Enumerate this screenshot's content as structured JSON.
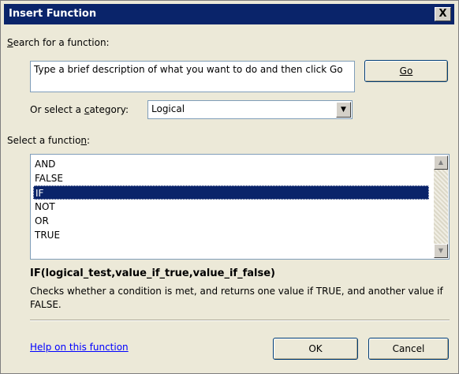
{
  "window": {
    "title": "Insert Function",
    "help_button": "?",
    "close_button": "X"
  },
  "search": {
    "label_prefix": "",
    "label_accel": "S",
    "label_rest": "earch for a function:",
    "text": "Type a brief description of what you want to do and then click Go",
    "go_button": "Go"
  },
  "category": {
    "label_prefix": "Or select a ",
    "label_accel": "c",
    "label_rest": "ategory:",
    "value": "Logical"
  },
  "functions": {
    "label_prefix": "Select a functio",
    "label_accel": "n",
    "label_rest": ":",
    "items": [
      "AND",
      "FALSE",
      "IF",
      "NOT",
      "OR",
      "TRUE"
    ],
    "selected": "IF"
  },
  "details": {
    "syntax": "IF(logical_test,value_if_true,value_if_false)",
    "description": "Checks whether a condition is met, and returns one value if TRUE, and another value if FALSE."
  },
  "footer": {
    "help_link": "Help on this function",
    "ok_button": "OK",
    "cancel_button": "Cancel"
  },
  "colors": {
    "title_bar": "#0a246a",
    "selection": "#0a246a",
    "link": "#0000ff"
  }
}
